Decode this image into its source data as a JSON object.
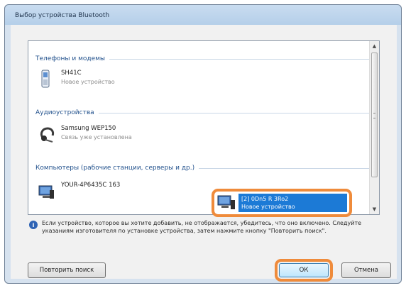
{
  "window": {
    "title": "Выбор устройства Bluetooth"
  },
  "groups": [
    {
      "header": "Телефоны и модемы"
    },
    {
      "header": "Аудиоустройства"
    },
    {
      "header": "Компьютеры (рабочие станции, серверы и др.)"
    }
  ],
  "devices": {
    "phone": {
      "name": "SH41C",
      "status": "Новое устройство",
      "icon": "mobile-phone-icon"
    },
    "headset": {
      "name": "Samsung WEP150",
      "status": "Связь уже установлена",
      "icon": "headset-icon"
    },
    "computer1": {
      "name": "YOUR-4P6435C 163",
      "status": "",
      "icon": "computer-icon"
    },
    "computer2": {
      "name": "[2] 0Dn5 R 3Ro2",
      "status": "Новое устройство",
      "icon": "computer-icon",
      "selected": true
    }
  },
  "info": {
    "text": "Если устройство, которое вы хотите добавить, не отображается, убедитесь, что оно включено. Следуйте указаниям изготовителя по установке устройства, затем нажмите кнопку \"Повторить поиск\"."
  },
  "buttons": {
    "retry": "Повторить поиск",
    "ok": "ОК",
    "cancel": "Отмена"
  },
  "colors": {
    "highlight": "#ef8b3b",
    "selection": "#1c7ad6",
    "group_header": "#1f4f8b"
  }
}
